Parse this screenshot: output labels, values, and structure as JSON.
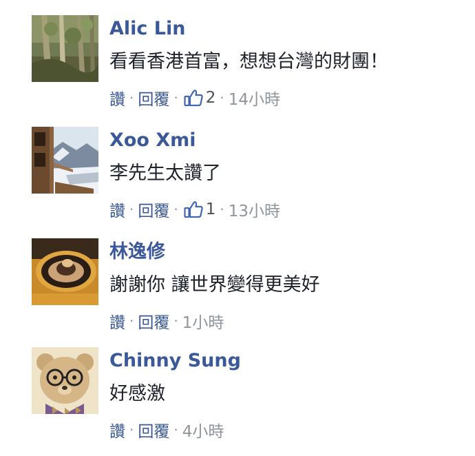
{
  "comments": [
    {
      "author": "Alic Lin",
      "text": "看看香港首富，想想台灣的財團！",
      "like_action": "讚",
      "reply_action": "回覆",
      "separator": "·",
      "like_count": "2",
      "time": "14小時",
      "avatar_icon": "bamboo-forest-photo"
    },
    {
      "author": "Xoo Xmi",
      "text": "李先生太讚了",
      "like_action": "讚",
      "reply_action": "回覆",
      "separator": "·",
      "like_count": "1",
      "time": "13小時",
      "avatar_icon": "snowy-mountain-cabin-photo"
    },
    {
      "author": "林逸修",
      "text": "謝謝你 讓世界變得更美好",
      "like_action": "讚",
      "reply_action": "回覆",
      "separator": "·",
      "time": "1小時",
      "avatar_icon": "dessert-plate-photo"
    },
    {
      "author": "Chinny Sung",
      "text": "好感激",
      "like_action": "讚",
      "reply_action": "回覆",
      "separator": "·",
      "time": "4小時",
      "avatar_icon": "teddy-bear-glasses-photo"
    }
  ],
  "colors": {
    "name_link": "#3b5998",
    "body_text": "#1d2129",
    "meta_gray": "#90949c",
    "like_icon": "#4267b2"
  }
}
